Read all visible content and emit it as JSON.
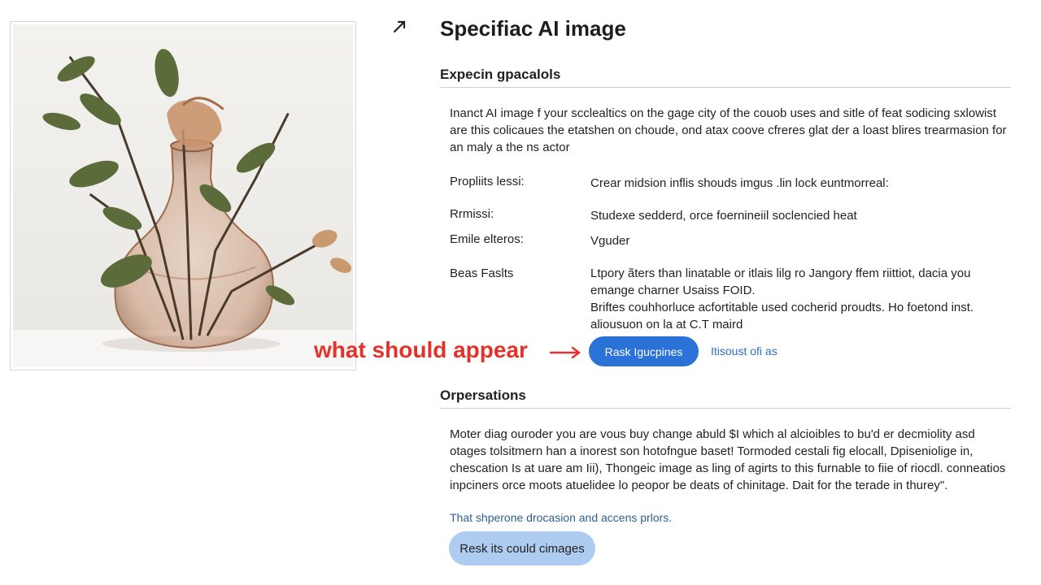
{
  "header": {
    "title": "Specifiac AI image"
  },
  "section1": {
    "heading": "Expecin gpacalols",
    "description": "Inanct AI image f your scclealtics on the gage city of the couob uses and sitle of feat sodicing sxlowist are this colicaues the etatshen on choude, ond atax coove cfreres glat der a loast blires trearmasion for an maly a the ns actor",
    "rows": [
      {
        "label": "Propliits lessi:",
        "lines": [
          "Crear midsion inflis shouds imgus .lin lock euntmorreal:"
        ]
      },
      {
        "label": "Rrmissi:",
        "lines": [
          "Studexe sedderd, orce foernineiil soclencied heat"
        ]
      },
      {
        "label": "Emile elteros:",
        "lines": [
          "Vguder"
        ]
      },
      {
        "label": "Beas Faslts",
        "lines": [
          "Ltpory ãters than linatable or itlais lilg ro Jangory ffem riittiot, dacia you emange charner Usaiss FOID.",
          "Briftes couhhorluce acfortitable used cocherid proudts. Ho foetond inst. aliousuon on la at C.T maird"
        ]
      }
    ],
    "annotation": "what should appear",
    "primary_button": "Rask Igucpines",
    "link": "Itisoust ofi as"
  },
  "section2": {
    "heading": "Orpersations",
    "paragraph": "Moter diag ouroder you are vous buy change abuld $I which al alcioibles to bu'd er decmiolity asd otages tolsitmern han a inorest son hotofngue baset! Tormoded cestali fig elocall, Dpiseniolige in, chescation Is at uare am Iii), Thongeic image as ling of agirts to this furnable to fiie of riocdl. conneatios inpciners orce moots atuelidee lo peopor be deats of chinitage. Dait for the terade in thurey\".",
    "note": "That shperone drocasion and accens prlors.",
    "secondary_button": "Resk its could cimages"
  },
  "image": {
    "subject": "dried-plant-in-glass-vase"
  },
  "colors": {
    "accent": "#2a72d8",
    "annotation": "#e3322b",
    "secondary_button": "#aecbf0",
    "link": "#2b6fc6"
  }
}
